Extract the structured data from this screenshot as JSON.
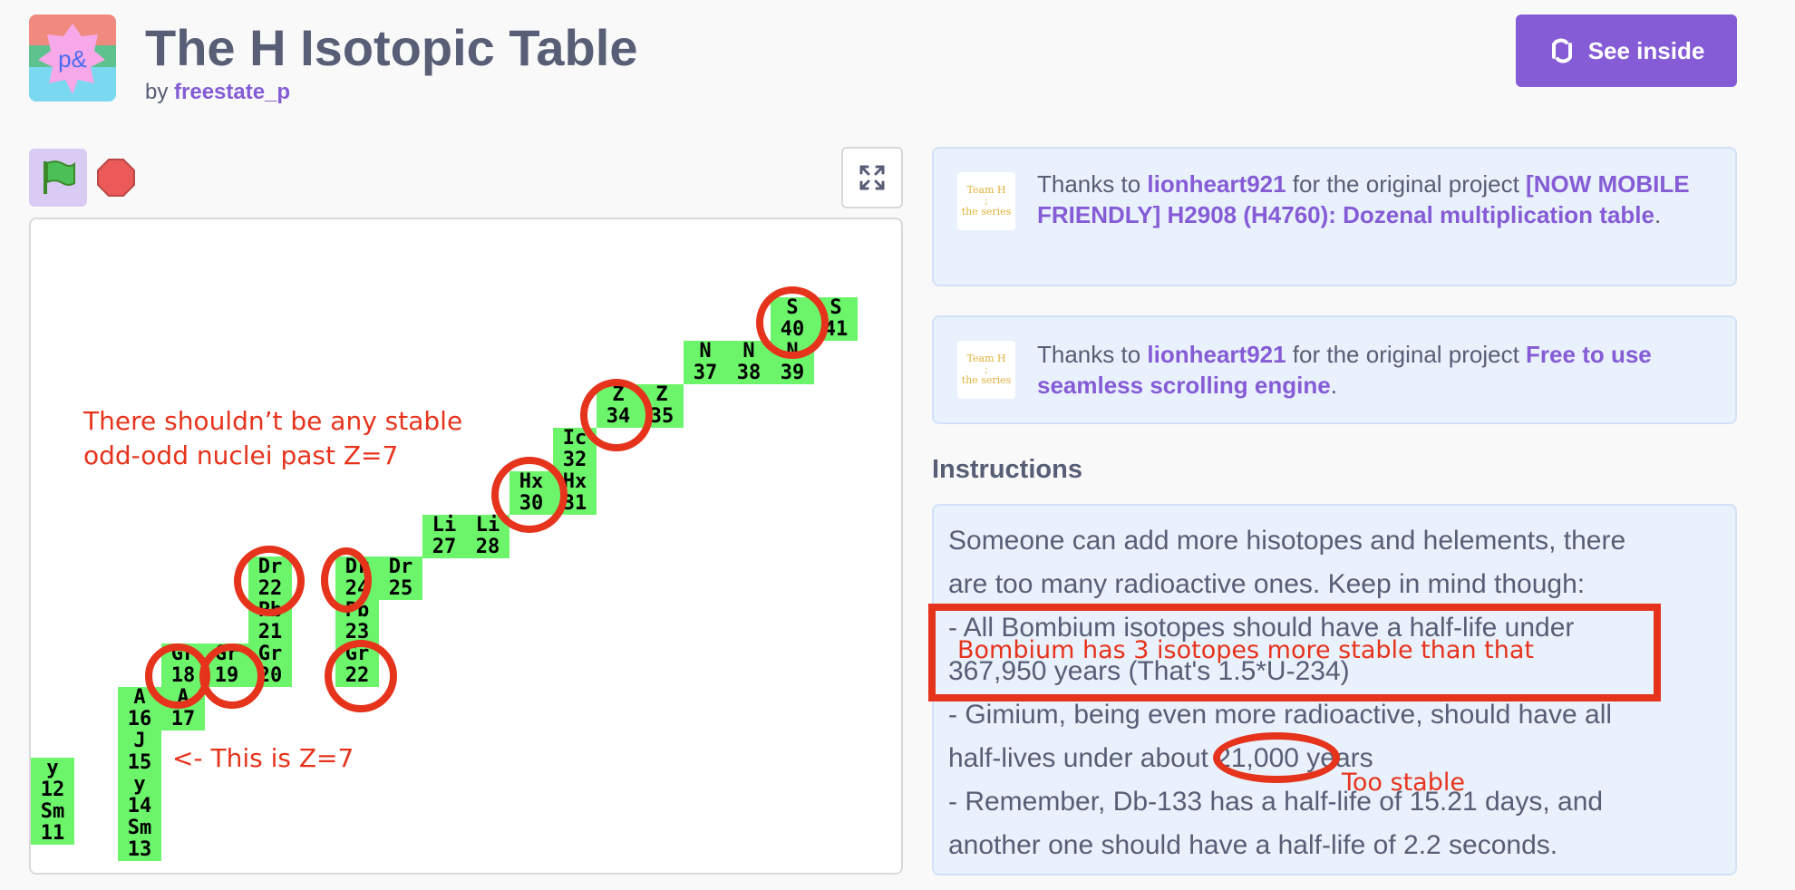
{
  "header": {
    "title": "The H Isotopic Table",
    "by_prefix": "by",
    "author": "freestate_p",
    "thumbnail_glyph": "p&",
    "see_inside_label": "See inside"
  },
  "player": {
    "flag_icon": "green-flag-icon",
    "stop_icon": "stop-icon",
    "fullscreen_icon": "fullscreen-icon"
  },
  "stage": {
    "cells": [
      {
        "sym": "y",
        "num": "12"
      },
      {
        "sym": "Sm",
        "num": "11"
      },
      {
        "sym": "A",
        "num": "16"
      },
      {
        "sym": "J",
        "num": "15"
      },
      {
        "sym": "y",
        "num": "14"
      },
      {
        "sym": "Sm",
        "num": "13"
      },
      {
        "sym": "A",
        "num": "17"
      },
      {
        "sym": "Gr",
        "num": "18"
      },
      {
        "sym": "Gr",
        "num": "19"
      },
      {
        "sym": "Gr",
        "num": "20"
      },
      {
        "sym": "Pb",
        "num": "21"
      },
      {
        "sym": "Dr",
        "num": "22"
      },
      {
        "sym": "Gr",
        "num": "22"
      },
      {
        "sym": "Pb",
        "num": "23"
      },
      {
        "sym": "Dr",
        "num": "24"
      },
      {
        "sym": "Dr",
        "num": "25"
      },
      {
        "sym": "Li",
        "num": "27"
      },
      {
        "sym": "Li",
        "num": "28"
      },
      {
        "sym": "Hx",
        "num": "30"
      },
      {
        "sym": "Hx",
        "num": "31"
      },
      {
        "sym": "Ic",
        "num": "32"
      },
      {
        "sym": "Z",
        "num": "34"
      },
      {
        "sym": "Z",
        "num": "35"
      },
      {
        "sym": "N",
        "num": "37"
      },
      {
        "sym": "N",
        "num": "38"
      },
      {
        "sym": "N",
        "num": "39"
      },
      {
        "sym": "S",
        "num": "40"
      },
      {
        "sym": "S",
        "num": "41"
      }
    ],
    "annotation_odd_odd_1": "There shouldn’t be any stable",
    "annotation_odd_odd_2": "odd-odd nuclei past Z=7",
    "annotation_z7": "<- This is Z=7"
  },
  "credits": [
    {
      "prefix": "Thanks to ",
      "user": "lionheart921",
      "middle": " for the original project ",
      "project": "[NOW MOBILE FRIENDLY] H2908 (H4760): Dozenal multiplication table",
      "suffix": "."
    },
    {
      "prefix": "Thanks to ",
      "user": "lionheart921",
      "middle": " for the original project ",
      "project": "Free to use seamless scrolling engine",
      "suffix": "."
    }
  ],
  "credit_avatar_text": [
    "Team H",
    ";",
    "the series"
  ],
  "instructions": {
    "heading": "Instructions",
    "lines": [
      "Someone can add more hisotopes and helements, there",
      "are too many radioactive ones. Keep in mind though:",
      "- All Bombium isotopes should have a half-life under",
      "367,950 years (That's 1.5*U-234)",
      "- Gimium, being even more radioactive, should have all",
      "half-lives under about 21,000 years",
      "- Remember, Db-133 has a half-life of 15.21 days, and",
      "another one should have a half-life of 2.2 seconds."
    ],
    "annotation_bombium": "Bombium has 3 isotopes more stable than that",
    "annotation_too_stable": "Too stable"
  },
  "colors": {
    "accent": "#855cd6",
    "cell_green": "#6cf56b",
    "annotation_red": "#e6331c"
  }
}
